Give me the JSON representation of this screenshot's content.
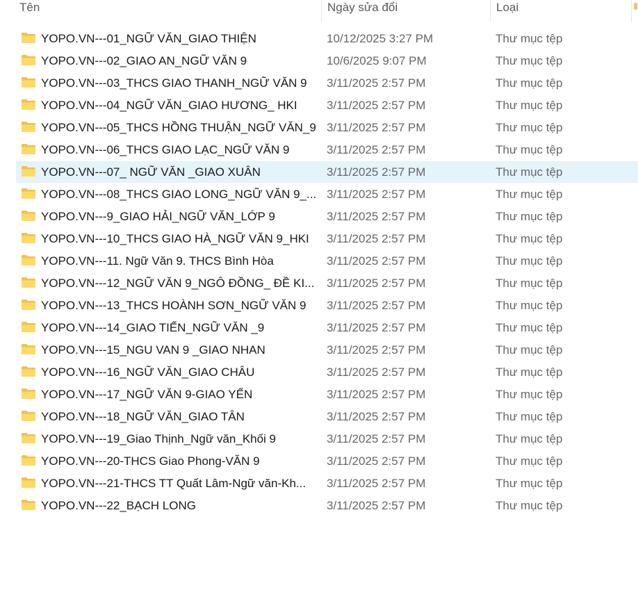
{
  "columns": {
    "name": "Tên",
    "date": "Ngày sửa đổi",
    "type": "Loại"
  },
  "files": [
    {
      "name": "YOPO.VN---01_NGỮ VĂN_GIAO THIỆN",
      "date": "10/12/2025 3:27 PM",
      "type": "Thư mục tệp",
      "icon": "folder-icon"
    },
    {
      "name": "YOPO.VN---02_GIAO AN_NGỮ VĂN 9",
      "date": "10/6/2025 9:07 PM",
      "type": "Thư mục tệp",
      "icon": "folder-icon"
    },
    {
      "name": "YOPO.VN---03_THCS GIAO THANH_NGỮ VĂN 9",
      "date": "3/11/2025 2:57 PM",
      "type": "Thư mục tệp",
      "icon": "folder-icon"
    },
    {
      "name": "YOPO.VN---04_NGỮ VĂN_GIAO HƯƠNG_ HKI",
      "date": "3/11/2025 2:57 PM",
      "type": "Thư mục tệp",
      "icon": "folder-icon"
    },
    {
      "name": "YOPO.VN---05_THCS HỒNG THUẬN_NGỮ VĂN_9",
      "date": "3/11/2025 2:57 PM",
      "type": "Thư mục tệp",
      "icon": "folder-icon"
    },
    {
      "name": "YOPO.VN---06_THCS GIAO LẠC_NGỮ VĂN 9",
      "date": "3/11/2025 2:57 PM",
      "type": "Thư mục tệp",
      "icon": "folder-icon"
    },
    {
      "name": "YOPO.VN---07_ NGỮ VĂN _GIAO XUÂN",
      "date": "3/11/2025 2:57 PM",
      "type": "Thư mục tệp",
      "icon": "folder-icon",
      "selected": true
    },
    {
      "name": "YOPO.VN---08_THCS GIAO LONG_NGỮ VĂN 9_...",
      "date": "3/11/2025 2:57 PM",
      "type": "Thư mục tệp",
      "icon": "folder-icon"
    },
    {
      "name": "YOPO.VN---9_GIAO HẢI_NGỮ VĂN_LỚP 9",
      "date": "3/11/2025 2:57 PM",
      "type": "Thư mục tệp",
      "icon": "folder-icon"
    },
    {
      "name": "YOPO.VN---10_THCS GIAO HÀ_NGỮ VĂN 9_HKI",
      "date": "3/11/2025 2:57 PM",
      "type": "Thư mục tệp",
      "icon": "folder-icon"
    },
    {
      "name": "YOPO.VN---11. Ngữ Văn 9. THCS Bình Hòa",
      "date": "3/11/2025 2:57 PM",
      "type": "Thư mục tệp",
      "icon": "folder-icon"
    },
    {
      "name": "YOPO.VN---12_NGỮ VĂN 9_NGÔ ĐỒNG_ ĐỀ KI...",
      "date": "3/11/2025 2:57 PM",
      "type": "Thư mục tệp",
      "icon": "folder-icon"
    },
    {
      "name": "YOPO.VN---13_THCS HOÀNH SƠN_NGỮ VĂN 9",
      "date": "3/11/2025 2:57 PM",
      "type": "Thư mục tệp",
      "icon": "folder-icon"
    },
    {
      "name": "YOPO.VN---14_GIAO TIẾN_NGỮ VĂN _9",
      "date": "3/11/2025 2:57 PM",
      "type": "Thư mục tệp",
      "icon": "folder-icon"
    },
    {
      "name": "YOPO.VN---15_NGU VAN 9 _GIAO NHAN",
      "date": "3/11/2025 2:57 PM",
      "type": "Thư mục tệp",
      "icon": "folder-icon"
    },
    {
      "name": "YOPO.VN---16_NGỮ VĂN_GIAO CHÂU",
      "date": "3/11/2025 2:57 PM",
      "type": "Thư mục tệp",
      "icon": "folder-icon"
    },
    {
      "name": "YOPO.VN---17_NGỮ VĂN 9-GIAO YẾN",
      "date": "3/11/2025 2:57 PM",
      "type": "Thư mục tệp",
      "icon": "folder-icon"
    },
    {
      "name": "YOPO.VN---18_NGỮ VĂN_GIAO TÂN",
      "date": "3/11/2025 2:57 PM",
      "type": "Thư mục tệp",
      "icon": "folder-icon"
    },
    {
      "name": "YOPO.VN---19_Giao Thịnh_Ngữ văn_Khối 9",
      "date": "3/11/2025 2:57 PM",
      "type": "Thư mục tệp",
      "icon": "folder-icon"
    },
    {
      "name": "YOPO.VN---20-THCS Giao Phong-VĂN 9",
      "date": "3/11/2025 2:57 PM",
      "type": "Thư mục tệp",
      "icon": "folder-icon"
    },
    {
      "name": "YOPO.VN---21-THCS TT Quất Lâm-Ngữ văn-Kh...",
      "date": "3/11/2025 2:57 PM",
      "type": "Thư mục tệp",
      "icon": "folder-icon"
    },
    {
      "name": "YOPO.VN---22_BẠCH LONG",
      "date": "3/11/2025 2:57 PM",
      "type": "Thư mục tệp",
      "icon": "folder-icon"
    }
  ],
  "colors": {
    "selection": "#e5f3fb",
    "folder_body": "#ffd966",
    "folder_tab": "#f0c14b"
  }
}
